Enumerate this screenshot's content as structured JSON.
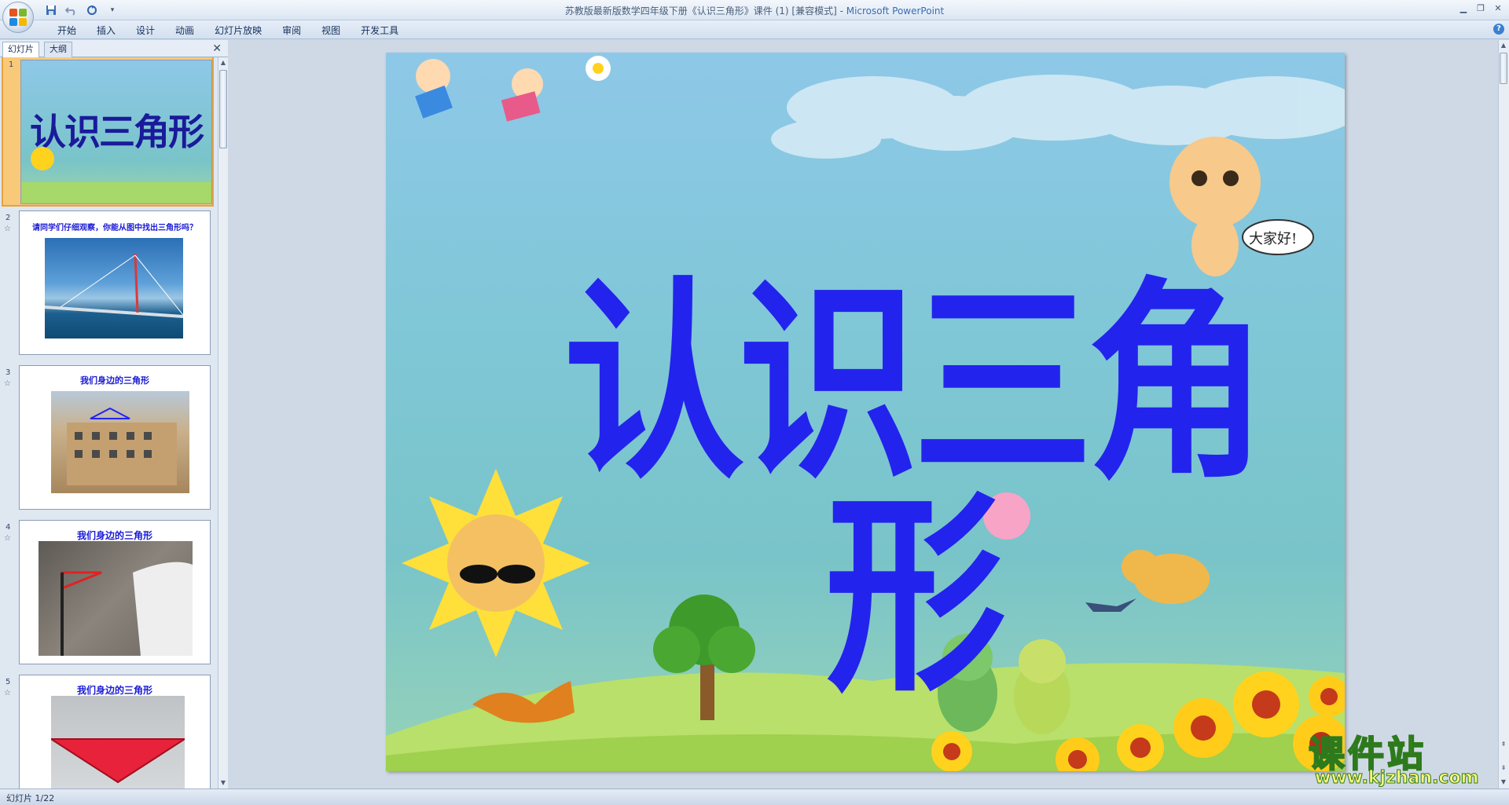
{
  "window": {
    "title": "苏教版最新版数学四年级下册《认识三角形》课件 (1) [兼容模式] - ",
    "app_name": "Microsoft PowerPoint"
  },
  "ribbon": {
    "tabs": [
      "开始",
      "插入",
      "设计",
      "动画",
      "幻灯片放映",
      "审阅",
      "视图",
      "开发工具"
    ]
  },
  "left_panel": {
    "tab_slides": "幻灯片",
    "tab_outline": "大纲",
    "thumbnails": [
      {
        "num": "1",
        "title": "认识三角形",
        "selected": true
      },
      {
        "num": "2",
        "title": "请同学们仔细观察，你能从图中找出三角形吗？"
      },
      {
        "num": "3",
        "title": "我们身边的三角形"
      },
      {
        "num": "4",
        "title": "我们身边的三角形"
      },
      {
        "num": "5",
        "title": "我们身边的三角形"
      }
    ]
  },
  "slide": {
    "title": "认识三角形",
    "speech_bubble": "大家好!"
  },
  "status": {
    "slide_counter": "幻灯片 1/22"
  },
  "watermark": {
    "big": "课件站",
    "small": "www.kjzhan.com"
  },
  "colors": {
    "slide_title": "#2323ee",
    "thumb_title": "#1a1ad6",
    "selection": "#f9c97a"
  }
}
